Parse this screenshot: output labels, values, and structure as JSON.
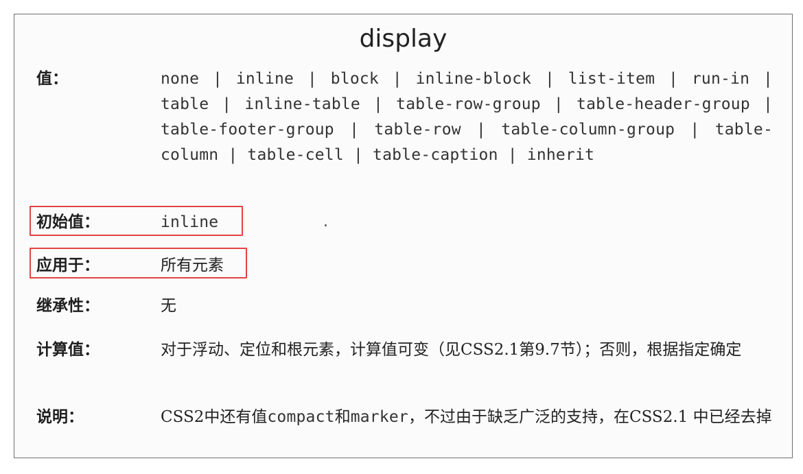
{
  "title": "display",
  "properties": {
    "values": {
      "label": "值：",
      "value": "none | inline | block | inline-block | list-item | run-in | table | inline-table | table-row-group | table-header-group | table-footer-group | table-row | table-column-group | table-column | table-cell | table-caption | inherit"
    },
    "initial": {
      "label": "初始值：",
      "value": "inline"
    },
    "applies_to": {
      "label": "应用于：",
      "value": "所有元素"
    },
    "inherited": {
      "label": "继承性：",
      "value": "无"
    },
    "computed": {
      "label": "计算值：",
      "value": "对于浮动、定位和根元素，计算值可变（见CSS2.1第9.7节）；否则，根据指定确定"
    },
    "notes": {
      "label": "说明：",
      "prefix": "CSS2中还有值",
      "code1": "compact",
      "middle": "和",
      "code2": "marker",
      "suffix": "，不过由于缺乏广泛的支持，在CSS2.1 中已经去掉"
    }
  },
  "highlight_color": "#e24343"
}
